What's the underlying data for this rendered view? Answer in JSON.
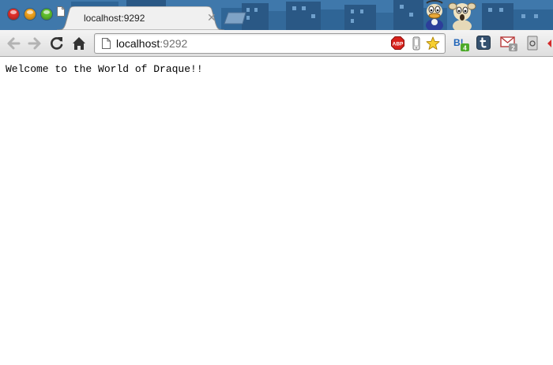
{
  "browser": {
    "tab": {
      "title": "localhost:9292"
    },
    "omnibox": {
      "host": "localhost",
      "port": ":9292"
    },
    "extensions": {
      "adblock_label": "ABP",
      "hatena_label": "B!",
      "hatena_badge": "4",
      "mail_badge": "2"
    },
    "theme_colors": {
      "sky": "#3f78ab",
      "buildings": "#2a5885",
      "windows": "#6fa0cc"
    }
  },
  "page": {
    "text": "Welcome to the World of Draque!!"
  }
}
